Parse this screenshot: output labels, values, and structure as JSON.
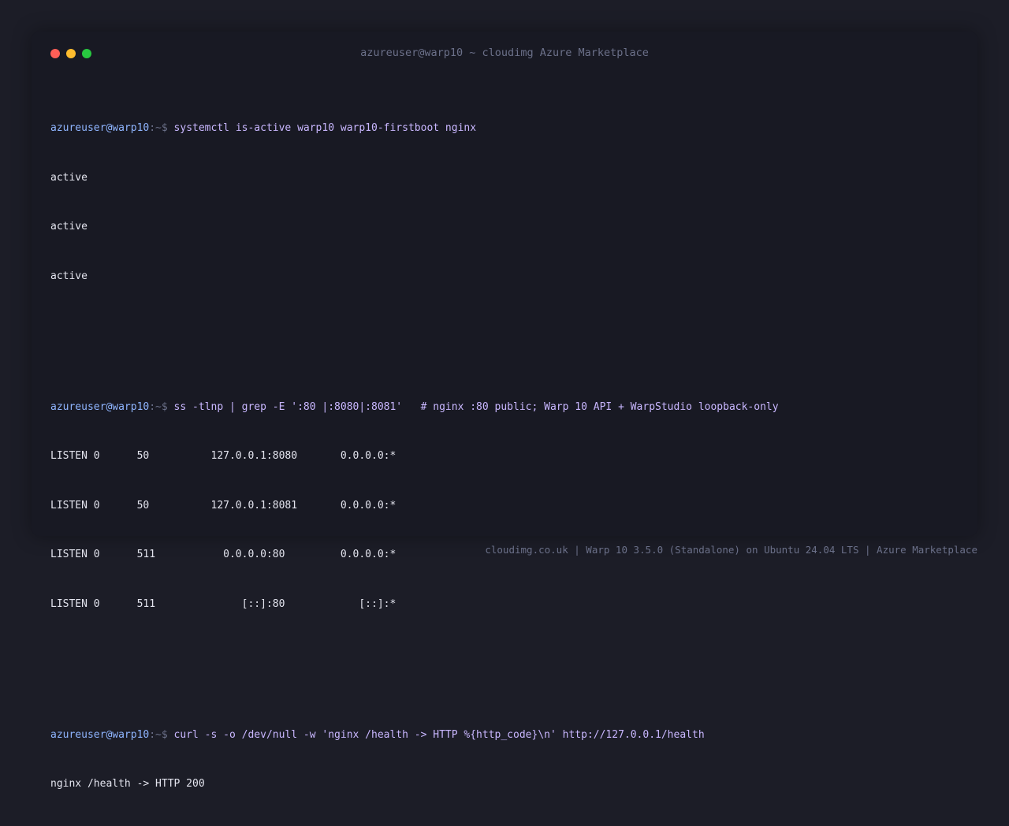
{
  "window": {
    "title": "azureuser@warp10 ~ cloudimg Azure Marketplace"
  },
  "prompt": {
    "user_host": "azureuser@warp10",
    "path_symbol": ":~$ "
  },
  "blocks": [
    {
      "command": "systemctl is-active warp10 warp10-firstboot nginx",
      "output": [
        "active",
        "active",
        "active"
      ]
    },
    {
      "command": "ss -tlnp | grep -E ':80 |:8080|:8081'   # nginx :80 public; Warp 10 API + WarpStudio loopback-only",
      "output": [
        "LISTEN 0      50          127.0.0.1:8080       0.0.0.0:*",
        "LISTEN 0      50          127.0.0.1:8081       0.0.0.0:*",
        "LISTEN 0      511           0.0.0.0:80         0.0.0.0:*",
        "LISTEN 0      511              [::]:80            [::]:*"
      ]
    },
    {
      "command": "curl -s -o /dev/null -w 'nginx /health -> HTTP %{http_code}\\n' http://127.0.0.1/health",
      "output": [
        "nginx /health -> HTTP 200"
      ]
    }
  ],
  "footer": "cloudimg.co.uk | Warp 10 3.5.0 (Standalone) on Ubuntu 24.04 LTS | Azure Marketplace",
  "colors": {
    "background": "#1c1d27",
    "window": "#181923",
    "prompt_user": "#8fb5ff",
    "command": "#c9b7ff",
    "dim": "#6b7089",
    "close": "#fe5f57",
    "minimize": "#febc2e",
    "maximize": "#28c840"
  }
}
